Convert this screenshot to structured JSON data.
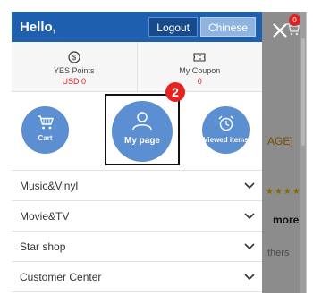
{
  "drawer": {
    "greeting": "Hello,",
    "logout_label": "Logout",
    "language_label": "Chinese",
    "stats": [
      {
        "label": "YES Points",
        "value": "USD 0",
        "icon": "dollar-coin-icon"
      },
      {
        "label": "My Coupon",
        "value": "0",
        "icon": "coupon-ticket-icon"
      }
    ],
    "shortcuts": [
      {
        "label": "Cart",
        "icon": "cart-icon"
      },
      {
        "label": "My page",
        "icon": "person-icon"
      },
      {
        "label": "Viewed items",
        "icon": "alarm-clock-icon"
      }
    ],
    "step_number": "2",
    "menu": [
      {
        "label": "Music&Vinyl"
      },
      {
        "label": "Movie&TV"
      },
      {
        "label": "Star shop"
      },
      {
        "label": "Customer Center"
      }
    ]
  },
  "background": {
    "close_icon": "close-icon",
    "cart_badge": "0",
    "text_fragments": [
      "AGE]",
      "more",
      "thers"
    ]
  },
  "colors": {
    "header_blue": "#1f5fb0",
    "circle_blue": "#5b8fd1",
    "accent_red": "#e02020"
  }
}
